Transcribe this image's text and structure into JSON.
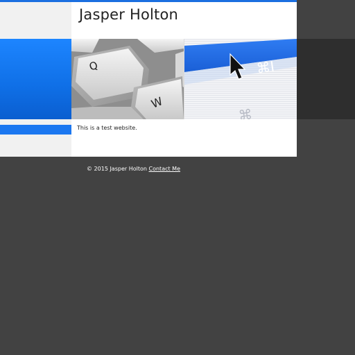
{
  "header": {
    "site_title": "Jasper Holton"
  },
  "banner": {
    "keyboard_keys": [
      "Q",
      "W"
    ],
    "menu_shortcuts": [
      "⌘I",
      "⌘"
    ]
  },
  "main": {
    "body_text": "This is a test website."
  },
  "footer": {
    "copyright": "© 2015 Jasper Holton",
    "contact_link": "Contact Me"
  },
  "colors": {
    "accent_blue": "#1b77f0",
    "page_background": "#424242",
    "panel_white": "#ffffff"
  }
}
